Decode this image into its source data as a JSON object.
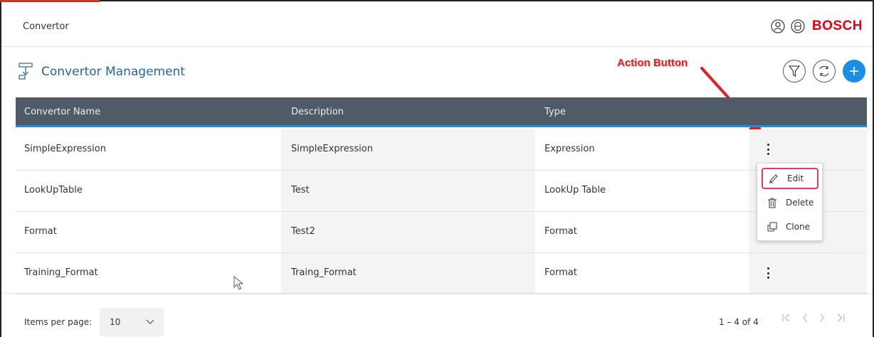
{
  "header": {
    "app_title": "Convertor",
    "brand": "BOSCH",
    "icons": [
      "user-icon",
      "bosch-logo-icon"
    ]
  },
  "titlebar": {
    "title": "Convertor Management",
    "icon": "convertor-icon",
    "tools": [
      "filter-icon",
      "refresh-icon",
      "add-icon"
    ]
  },
  "annotation": {
    "label": "Action Button",
    "color": "#e51c1c"
  },
  "table": {
    "columns": [
      "Convertor Name",
      "Description",
      "Type"
    ],
    "rows": [
      {
        "name": "SimpleExpression",
        "description": "SimpleExpression",
        "type": "Expression"
      },
      {
        "name": "LookUpTable",
        "description": "Test",
        "type": "LookUp Table"
      },
      {
        "name": "Format",
        "description": "Test2",
        "type": "Format"
      },
      {
        "name": "Training_Format",
        "description": "Traing_Format",
        "type": "Format"
      }
    ]
  },
  "action_menu": {
    "items": [
      {
        "label": "Edit",
        "icon": "pencil-icon"
      },
      {
        "label": "Delete",
        "icon": "trash-icon"
      },
      {
        "label": "Clone",
        "icon": "clone-icon"
      }
    ]
  },
  "footer": {
    "items_per_page_label": "Items per page:",
    "items_per_page_value": "10",
    "range_label": "1 – 4 of 4"
  },
  "colors": {
    "header_bg": "#4f5b66",
    "accent": "#1a8fe3",
    "title": "#2566a0",
    "brand": "#e20015",
    "highlight": "#e2386a"
  }
}
